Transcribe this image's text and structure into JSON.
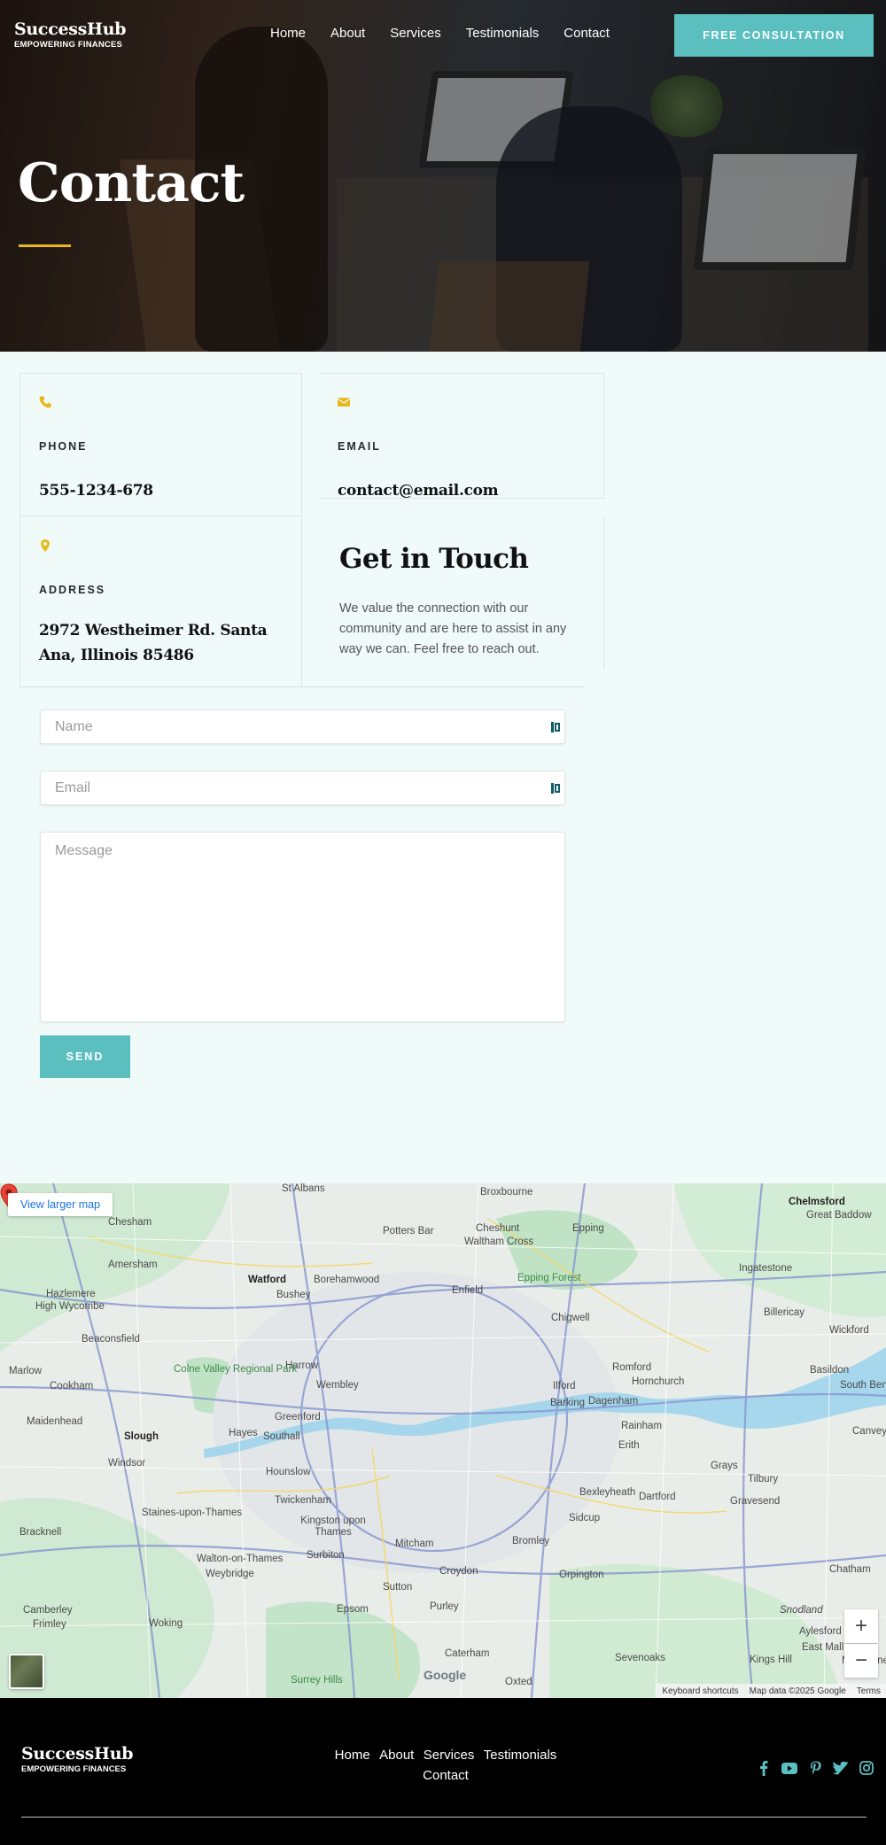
{
  "brand": {
    "name": "SuccessHub",
    "tagline": "EMPOWERING FINANCES"
  },
  "nav": {
    "items": [
      "Home",
      "About",
      "Services",
      "Testimonials",
      "Contact"
    ],
    "cta": "FREE CONSULTATION"
  },
  "hero": {
    "title": "Contact"
  },
  "contact": {
    "phone": {
      "icon": "phone-icon",
      "label": "PHONE",
      "value": "555-1234-678"
    },
    "email": {
      "icon": "envelope-icon",
      "label": "EMAIL",
      "value": "contact@email.com"
    },
    "address": {
      "icon": "map-marker-icon",
      "label": "ADDRESS",
      "value": "2972 Westheimer Rd. Santa Ana, Illinois 85486"
    },
    "get_in_touch": {
      "title": "Get in Touch",
      "text": "We value the connection with our community and are here to assist in any way we can. Feel free to reach out."
    }
  },
  "form": {
    "name_placeholder": "Name",
    "email_placeholder": "Email",
    "message_placeholder": "Message",
    "send_label": "SEND"
  },
  "map": {
    "larger_map": "View larger map",
    "zoom_in": "+",
    "zoom_out": "−",
    "google": "Google",
    "attribution": [
      "Keyboard shortcuts",
      "Map data ©2025 Google",
      "Terms"
    ],
    "labels": [
      "St Albans",
      "Broxbourne",
      "Chelmsford",
      "Great Baddow",
      "Chesham",
      "Potters Bar",
      "Cheshunt",
      "Waltham Cross",
      "Epping",
      "Amersham",
      "Watford",
      "Borehamwood",
      "Epping Forest",
      "Ingatestone",
      "Bushey",
      "Enfield",
      "Hazlemere",
      "High Wycombe",
      "Chigwell",
      "Billericay",
      "Beaconsfield",
      "Wickford",
      "Harrow",
      "Romford",
      "Hornchurch",
      "Basildon",
      "Marlow",
      "Colne Valley Regional Park",
      "Wembley",
      "Cookham",
      "Ilford",
      "Barking",
      "Dagenham",
      "South Ben",
      "Greenford",
      "Maidenhead",
      "Hayes",
      "Southall",
      "Rainham",
      "Canvey",
      "Slough",
      "Erith",
      "Windsor",
      "Hounslow",
      "Grays",
      "Tilbury",
      "Bexleyheath",
      "Dartford",
      "Gravesend",
      "Twickenham",
      "Staines-upon-Thames",
      "Kingston upon Thames",
      "Sidcup",
      "Bracknell",
      "Mitcham",
      "Bromley",
      "Walton-on-Thames",
      "Surbiton",
      "Chatham",
      "Weybridge",
      "Croydon",
      "Orpington",
      "Sutton",
      "Purley",
      "Camberley",
      "Frimley",
      "Woking",
      "Epsom",
      "Snodland",
      "Aylesford",
      "East Malling",
      "Kings Hill",
      "Maidstone",
      "Caterham",
      "Sevenoaks",
      "Oxted",
      "Surrey Hills"
    ]
  },
  "footer": {
    "links": [
      "Home",
      "About",
      "Services",
      "Testimonials",
      "Contact"
    ],
    "social": [
      "facebook-icon",
      "youtube-icon",
      "pinterest-icon",
      "twitter-icon",
      "instagram-icon"
    ]
  },
  "colors": {
    "accent": "#5bbfc0",
    "gold": "#e8b81c",
    "background": "#f0faf8",
    "footer": "#000000"
  }
}
